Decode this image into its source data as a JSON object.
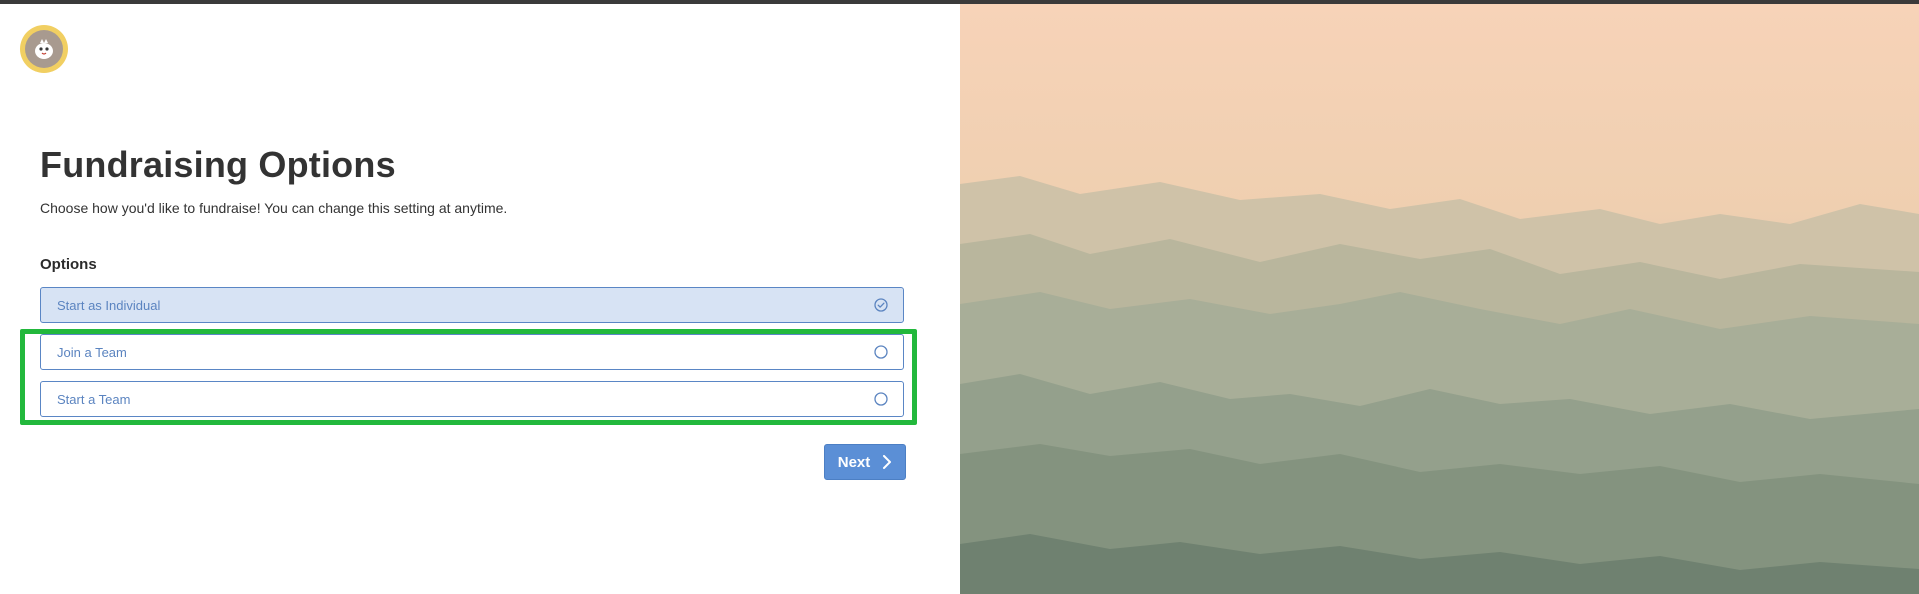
{
  "page": {
    "title": "Fundraising Options",
    "subtitle": "Choose how you'd like to fundraise! You can change this setting at anytime.",
    "options_label": "Options"
  },
  "options": [
    {
      "label": "Start as Individual",
      "selected": true,
      "icon": "check-circle-icon"
    },
    {
      "label": "Join a Team",
      "selected": false,
      "icon": "radio-circle-icon"
    },
    {
      "label": "Start a Team",
      "selected": false,
      "icon": "radio-circle-icon"
    }
  ],
  "next_button": {
    "label": "Next",
    "icon": "chevron-right-icon"
  },
  "colors": {
    "accent": "#5b8fd6",
    "option_border": "#5a86c5",
    "option_selected_bg": "#d7e3f4",
    "highlight": "#22b83c"
  }
}
